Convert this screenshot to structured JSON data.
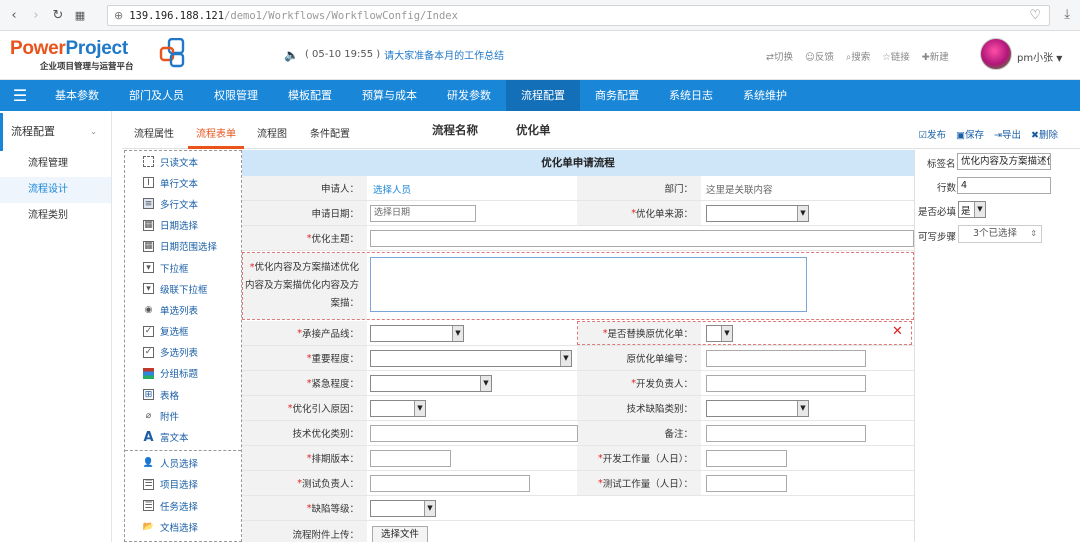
{
  "browser": {
    "url_host": "139.196.188.121",
    "url_path": "/demo1/Workflows/WorkflowConfig/Index"
  },
  "header": {
    "logo_brand_1": "Power",
    "logo_brand_2": "Project",
    "logo_sub": "企业项目管理与运营平台",
    "notice_prefix": "( 05-10 19:55 )",
    "notice_text": "请大家准备本月的工作总结",
    "tools": [
      "切换",
      "反馈",
      "搜索",
      "链接",
      "新建"
    ],
    "user": "pm小张"
  },
  "topnav": [
    "基本参数",
    "部门及人员",
    "权限管理",
    "模板配置",
    "预算与成本",
    "研发参数",
    "流程配置",
    "商务配置",
    "系统日志",
    "系统维护"
  ],
  "topnav_active": "流程配置",
  "sidebar": {
    "title": "流程配置",
    "items": [
      "流程管理",
      "流程设计",
      "流程类别"
    ],
    "active": "流程设计"
  },
  "tabs": [
    "流程属性",
    "流程表单",
    "流程图",
    "条件配置"
  ],
  "tab_active": "流程表单",
  "flow": {
    "name_label": "流程名称",
    "name_value": "优化单"
  },
  "actions": [
    "发布",
    "保存",
    "导出",
    "删除"
  ],
  "palette": {
    "group1": [
      "只读文本",
      "单行文本",
      "多行文本",
      "日期选择",
      "日期范围选择",
      "下拉框",
      "级联下拉框",
      "单选列表",
      "复选框",
      "多选列表",
      "分组标题",
      "表格",
      "附件",
      "富文本"
    ],
    "group2": [
      "人员选择",
      "项目选择",
      "任务选择",
      "文档选择"
    ]
  },
  "form": {
    "title": "优化单申请流程",
    "applicant_label": "申请人：",
    "applicant_value": "选择人员",
    "dept_label": "部门：",
    "dept_value": "这里是关联内容",
    "apply_date_label": "申请日期：",
    "apply_date_placeholder": "选择日期",
    "source_label": "优化单来源：",
    "subject_label": "优化主题：",
    "desc_label": "优化内容及方案描述优化内容及方案描优化内容及方案描：",
    "product_line_label": "承接产品线：",
    "replace_label": "是否替换原优化单：",
    "importance_label": "重要程度：",
    "orig_no_label": "原优化单编号：",
    "urgency_label": "紧急程度：",
    "dev_owner_label": "开发负责人：",
    "reason_label": "优化引入原因：",
    "tech_type_label": "技术缺陷类别：",
    "tech_opt_label": "技术优化类别：",
    "remark_label": "备注：",
    "version_label": "排期版本：",
    "dev_effort_label": "开发工作量（人日）：",
    "test_owner_label": "测试负责人：",
    "test_effort_label": "测试工作量（人日）：",
    "defect_level_label": "缺陷等级：",
    "attach_label": "流程附件上传：",
    "attach_button": "选择文件"
  },
  "props": {
    "tag_label": "标签名",
    "tag_value": "优化内容及方案描述优",
    "rows_label": "行数",
    "rows_value": "4",
    "required_label": "是否必填",
    "required_value": "是",
    "steps_label": "可写步骤",
    "steps_value": "3个已选择"
  }
}
